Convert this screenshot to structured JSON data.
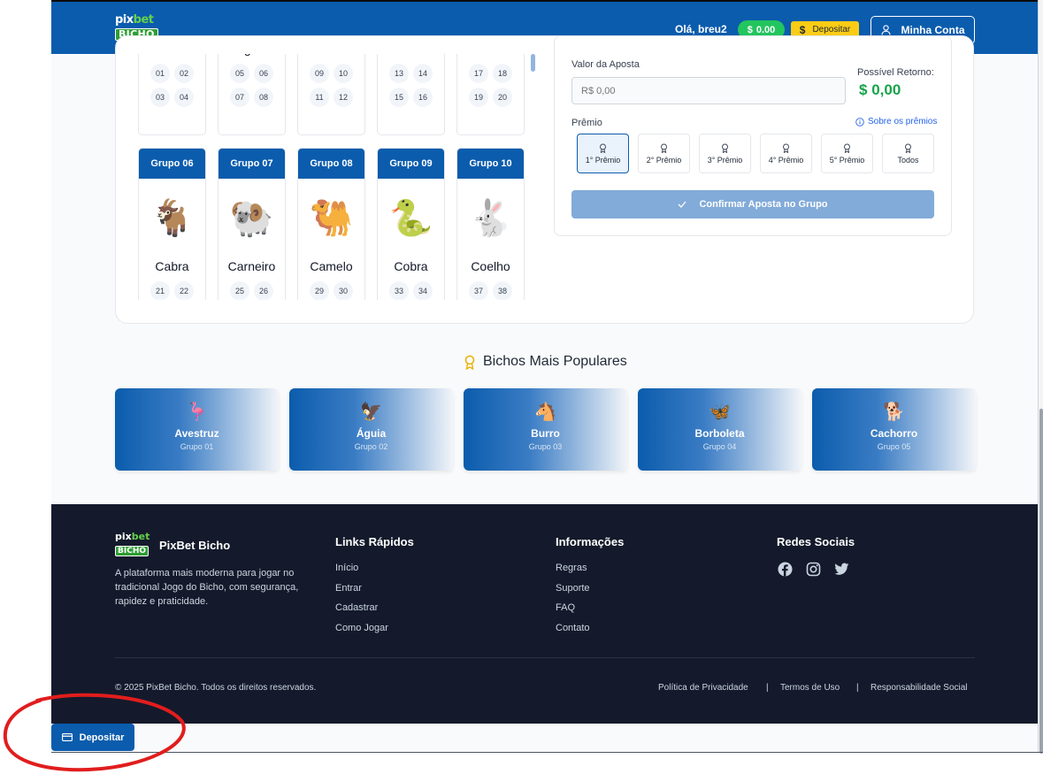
{
  "header": {
    "logo_top": "pixbet",
    "logo_bottom": "BICHO",
    "greeting": "Olá, breu2",
    "balance": "0.00",
    "balance_currency": "$",
    "deposit_label": "Depositar",
    "deposit_symbol": "$",
    "account_label": "Minha Conta"
  },
  "groups": [
    {
      "header": "",
      "name": "Avestruz",
      "emoji": "",
      "numbers": [
        "01",
        "02",
        "03",
        "04"
      ]
    },
    {
      "header": "",
      "name": "Águia",
      "emoji": "",
      "numbers": [
        "05",
        "06",
        "07",
        "08"
      ]
    },
    {
      "header": "",
      "name": "Burro",
      "emoji": "",
      "numbers": [
        "09",
        "10",
        "11",
        "12"
      ]
    },
    {
      "header": "",
      "name": "Borboleta",
      "emoji": "",
      "numbers": [
        "13",
        "14",
        "15",
        "16"
      ]
    },
    {
      "header": "",
      "name": "Cachorro",
      "emoji": "",
      "numbers": [
        "17",
        "18",
        "19",
        "20"
      ]
    },
    {
      "header": "Grupo 06",
      "name": "Cabra",
      "emoji": "🐐",
      "numbers": [
        "21",
        "22"
      ]
    },
    {
      "header": "Grupo 07",
      "name": "Carneiro",
      "emoji": "🐏",
      "numbers": [
        "25",
        "26"
      ]
    },
    {
      "header": "Grupo 08",
      "name": "Camelo",
      "emoji": "🐫",
      "numbers": [
        "29",
        "30"
      ]
    },
    {
      "header": "Grupo 09",
      "name": "Cobra",
      "emoji": "🐍",
      "numbers": [
        "33",
        "34"
      ]
    },
    {
      "header": "Grupo 10",
      "name": "Coelho",
      "emoji": "🐇",
      "numbers": [
        "37",
        "38"
      ]
    }
  ],
  "bet": {
    "amount_label": "Valor da Aposta",
    "amount_placeholder": "R$ 0,00",
    "possible_return_label": "Possível Retorno:",
    "possible_return_currency": "$",
    "possible_return_value": "0,00",
    "prize_label": "Prêmio",
    "about_prizes": "Sobre os prêmios",
    "prizes": [
      "1° Prêmio",
      "2° Prêmio",
      "3° Prêmio",
      "4° Prêmio",
      "5° Prêmio",
      "Todos"
    ],
    "selected_prize": "1° Prêmio",
    "confirm_label": "Confirmar Aposta no Grupo"
  },
  "popular": {
    "title": "Bichos Mais Populares",
    "items": [
      {
        "name": "Avestruz",
        "group": "Grupo 01",
        "emoji": "🦩"
      },
      {
        "name": "Águia",
        "group": "Grupo 02",
        "emoji": "🦅"
      },
      {
        "name": "Burro",
        "group": "Grupo 03",
        "emoji": "🐴"
      },
      {
        "name": "Borboleta",
        "group": "Grupo 04",
        "emoji": "🦋"
      },
      {
        "name": "Cachorro",
        "group": "Grupo 05",
        "emoji": "🐕"
      }
    ]
  },
  "footer": {
    "brand": "PixBet Bicho",
    "description": "A plataforma mais moderna para jogar no tradicional Jogo do Bicho, com segurança, rapidez e praticidade.",
    "quick_links_title": "Links Rápidos",
    "quick_links": [
      "Início",
      "Entrar",
      "Cadastrar",
      "Como Jogar"
    ],
    "info_title": "Informações",
    "info_links": [
      "Regras",
      "Suporte",
      "FAQ",
      "Contato"
    ],
    "social_title": "Redes Sociais",
    "social_icons": [
      "facebook-icon",
      "instagram-icon",
      "twitter-icon"
    ],
    "copyright": "© 2025 PixBet Bicho. Todos os direitos reservados.",
    "legal_links": [
      "Política de Privacidade",
      "Termos de Uso",
      "Responsabilidade Social"
    ],
    "legal_separator": "|"
  },
  "floating": {
    "deposit_label": "Depositar"
  },
  "colors": {
    "primary": "#0b5cad",
    "success": "#22c55e",
    "warning": "#facc15",
    "footer_bg": "#141a2b",
    "annotation": "#e11d1d"
  }
}
